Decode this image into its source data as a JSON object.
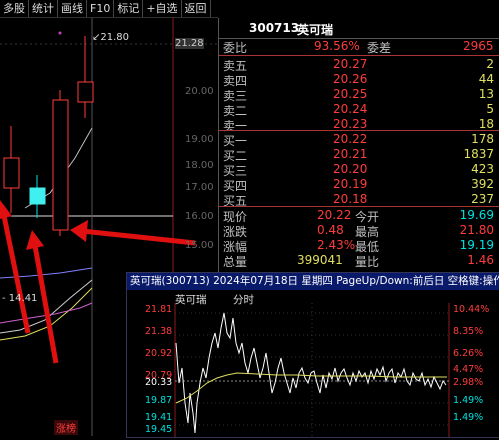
{
  "toolbar": [
    "多股",
    "统计",
    "画线",
    "F10",
    "标记",
    "+自选",
    "返回"
  ],
  "chart": {
    "max_label": "21.80",
    "price_axis": [
      "21.28",
      "20.00",
      "19.00",
      "18.00",
      "17.00",
      "16.00",
      "15.00"
    ],
    "ma_label": "- 14.41",
    "bottom_tag": "涨榜"
  },
  "quote": {
    "code": "300713",
    "name": "英可瑞",
    "weibi": {
      "label": "委比",
      "value": "93.56%",
      "label2": "委差",
      "value2": "2965"
    },
    "asks": [
      {
        "label": "卖五",
        "price": "20.27",
        "vol": "2"
      },
      {
        "label": "卖四",
        "price": "20.26",
        "vol": "44"
      },
      {
        "label": "卖三",
        "price": "20.25",
        "vol": "13"
      },
      {
        "label": "卖二",
        "price": "20.24",
        "vol": "5"
      },
      {
        "label": "卖一",
        "price": "20.23",
        "vol": "18"
      }
    ],
    "bids": [
      {
        "label": "买一",
        "price": "20.22",
        "vol": "178"
      },
      {
        "label": "买二",
        "price": "20.21",
        "vol": "1837"
      },
      {
        "label": "买三",
        "price": "20.20",
        "vol": "423"
      },
      {
        "label": "买四",
        "price": "20.19",
        "vol": "392"
      },
      {
        "label": "买五",
        "price": "20.18",
        "vol": "237"
      }
    ],
    "stats": [
      {
        "l1": "现价",
        "v1": "20.22",
        "l2": "今开",
        "v2": "19.69"
      },
      {
        "l1": "涨跌",
        "v1": "0.48",
        "l2": "最高",
        "v2": "21.80"
      },
      {
        "l1": "涨幅",
        "v1": "2.43%",
        "l2": "最低",
        "v2": "19.19"
      },
      {
        "l1": "总量",
        "v1": "399041",
        "l2": "量比",
        "v2": "1.46"
      }
    ]
  },
  "intraday": {
    "title": "英可瑞(300713) 2024年07月18日 星期四 PageUp/Down:前后日 空格键:操作",
    "name": "英可瑞",
    "period": "分时",
    "left_axis": [
      "21.81",
      "21.38",
      "20.92",
      "20.79",
      "20.33",
      "19.87",
      "19.41",
      "19.45"
    ],
    "right_axis": [
      "10.44%",
      "8.35%",
      "6.26%",
      "4.47%",
      "2.98%",
      "1.49%",
      "1.49%"
    ]
  },
  "colors": {
    "up": "#ff3c3c",
    "down": "#00e0e0",
    "label": "#c0c0c0",
    "arrow": "#e01010"
  }
}
